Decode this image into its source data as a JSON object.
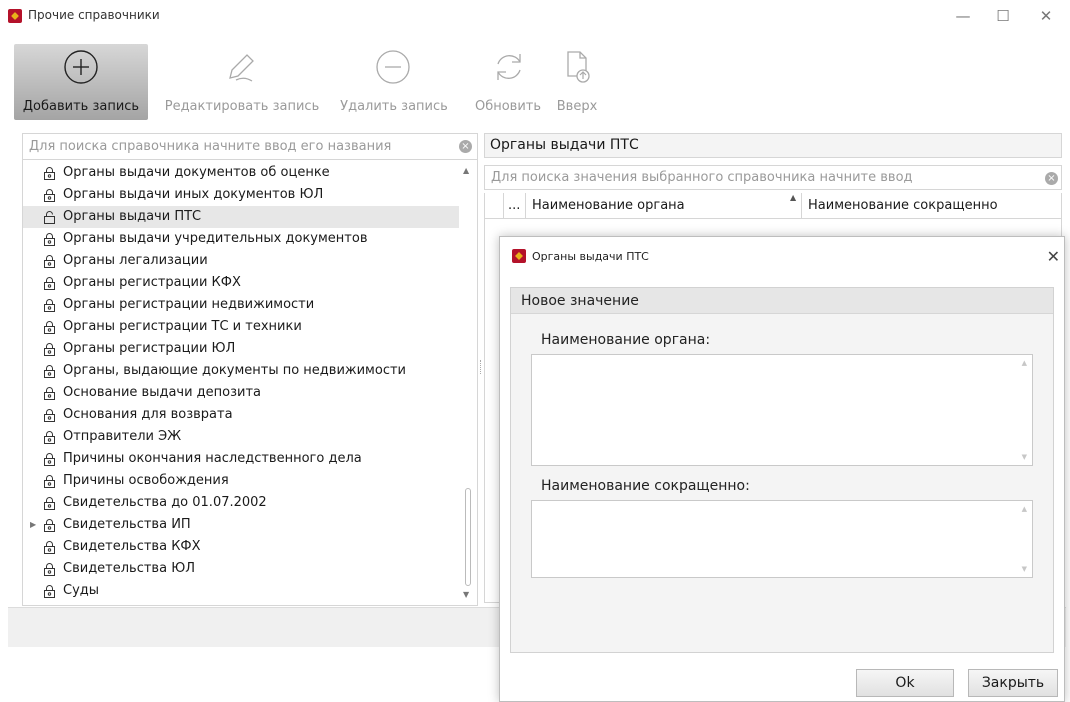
{
  "window": {
    "title": "Прочие справочники",
    "controls": [
      "—",
      "☐",
      "✕"
    ]
  },
  "toolbar": {
    "add_label": "Добавить запись",
    "edit_label": "Редактировать запись",
    "delete_label": "Удалить запись",
    "refresh_label": "Обновить",
    "up_label": "Вверх"
  },
  "left": {
    "search_placeholder": "Для поиска справочника начните ввод его названия",
    "items": [
      {
        "label": "Органы выдачи документов об оценке",
        "icon": "lock-icon"
      },
      {
        "label": "Органы выдачи иных документов ЮЛ",
        "icon": "lock-icon"
      },
      {
        "label": "Органы выдачи ПТС",
        "icon": "unlock-icon",
        "selected": true
      },
      {
        "label": "Органы выдачи учредительных документов",
        "icon": "lock-icon"
      },
      {
        "label": "Органы легализации",
        "icon": "lock-icon"
      },
      {
        "label": "Органы регистрации КФХ",
        "icon": "lock-icon"
      },
      {
        "label": "Органы регистрации недвижимости",
        "icon": "lock-icon"
      },
      {
        "label": "Органы регистрации ТС и техники",
        "icon": "lock-icon"
      },
      {
        "label": "Органы регистрации ЮЛ",
        "icon": "lock-icon"
      },
      {
        "label": "Органы, выдающие документы по недвижимости",
        "icon": "lock-icon"
      },
      {
        "label": "Основание выдачи депозита",
        "icon": "lock-icon"
      },
      {
        "label": "Основания для возврата",
        "icon": "lock-icon"
      },
      {
        "label": "Отправители ЭЖ",
        "icon": "lock-icon"
      },
      {
        "label": "Причины окончания наследственного дела",
        "icon": "lock-icon"
      },
      {
        "label": "Причины освобождения",
        "icon": "lock-icon"
      },
      {
        "label": "Свидетельства до 01.07.2002",
        "icon": "lock-icon"
      },
      {
        "label": "Свидетельства ИП",
        "icon": "lock-icon",
        "expandable": true
      },
      {
        "label": "Свидетельства КФХ",
        "icon": "lock-icon"
      },
      {
        "label": "Свидетельства ЮЛ",
        "icon": "lock-icon"
      },
      {
        "label": "Суды",
        "icon": "lock-icon"
      }
    ]
  },
  "right": {
    "header": "Органы выдачи ПТС",
    "search_placeholder": "Для поиска значения выбранного справочника начните ввод",
    "columns": [
      "...",
      "Наименование органа",
      "Наименование сокращенно"
    ]
  },
  "dialog": {
    "title": "Органы выдачи ПТС",
    "group_caption": "Новое значение",
    "field1_label": "Наименование органа:",
    "field1_value": "",
    "field2_label": "Наименование сокращенно:",
    "field2_value": "",
    "ok_label": "Ok",
    "close_label": "Закрыть"
  },
  "colors": {
    "accent": "#b4122a",
    "selection": "#e7e7e7"
  }
}
